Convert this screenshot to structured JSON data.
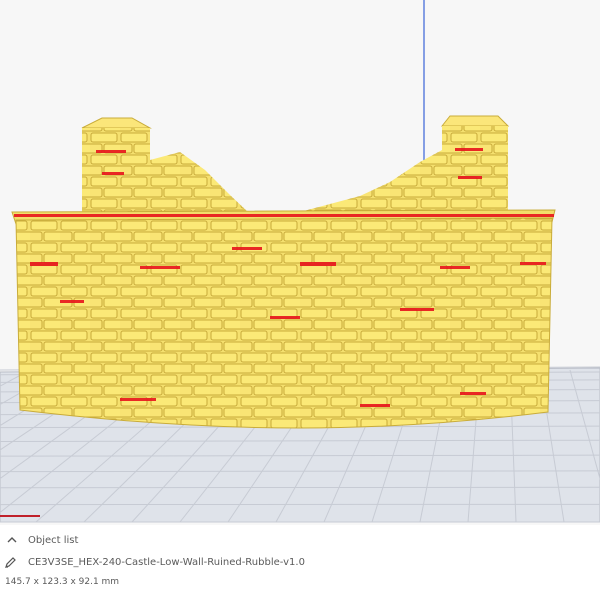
{
  "object_panel": {
    "header_label": "Object list",
    "file_name": "CE3V3SE_HEX-240-Castle-Low-Wall-Ruined-Rubble-v1.0",
    "dimensions": "145.7 x 123.3 x 92.1 mm"
  },
  "icons": {
    "collapse": "chevron-up-icon",
    "edit": "pencil-icon"
  },
  "colors": {
    "model_fill": "#f8e77a",
    "model_overhang": "#e8141c",
    "build_plate_grid": "#c7cbd4",
    "axis_blue": "#3a64d8"
  }
}
